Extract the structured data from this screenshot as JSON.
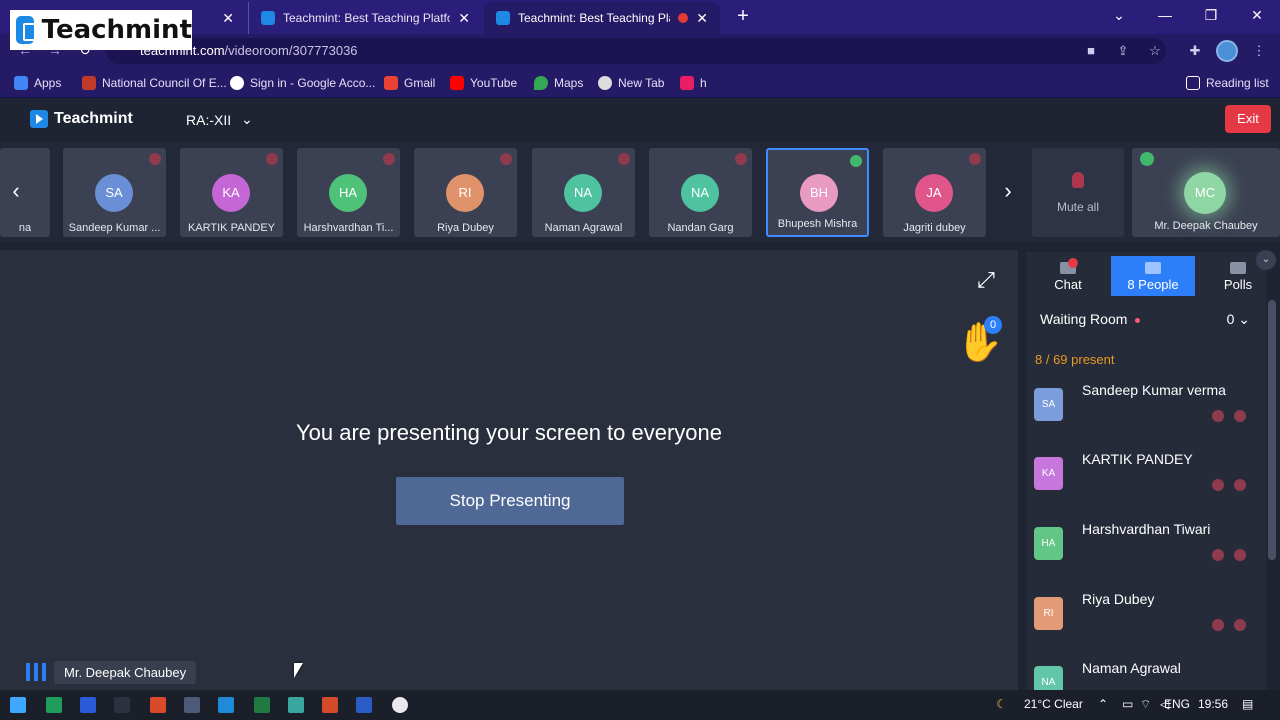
{
  "overlay_logo": "Teachmint",
  "browser": {
    "tabs": [
      {
        "title": "",
        "close": "✕"
      },
      {
        "title": "Teachmint: Best Teaching Platform",
        "close": "✕"
      },
      {
        "title": "Teachmint: Best Teaching Platfo",
        "close": "✕"
      }
    ],
    "new_tab": "+",
    "window_controls": {
      "dropdown": "⌄",
      "minimize": "—",
      "restore": "❐",
      "close": "✕"
    },
    "url_host": "teachmint.com",
    "url_path": "/videoroom/307773036",
    "bookmarks": [
      {
        "label": "Apps",
        "icon": "apps-grid-icon",
        "color": "#4285f4"
      },
      {
        "label": "National Council Of E...",
        "icon": "ncert-icon",
        "color": "#c0392b"
      },
      {
        "label": "Sign in - Google Acco...",
        "icon": "google-icon",
        "color": "#ffffff"
      },
      {
        "label": "Gmail",
        "icon": "gmail-icon",
        "color": "#ea4335"
      },
      {
        "label": "YouTube",
        "icon": "youtube-icon",
        "color": "#ff0000"
      },
      {
        "label": "Maps",
        "icon": "maps-icon",
        "color": "#34a853"
      },
      {
        "label": "New Tab",
        "icon": "globe-icon",
        "color": "#dddddd"
      },
      {
        "label": "h",
        "icon": "bookmark-h-icon",
        "color": "#e91e63"
      }
    ],
    "reading_list": "Reading list"
  },
  "app": {
    "brand": "Teachmint",
    "class_name": "RA:-XII",
    "exit_label": "Exit",
    "participants": [
      {
        "initials": "SA",
        "name": "Sandeep Kumar ...",
        "color": "#6b8fd6"
      },
      {
        "initials": "KA",
        "name": "KARTIK PANDEY",
        "color": "#c566d6"
      },
      {
        "initials": "HA",
        "name": "Harshvardhan Ti...",
        "color": "#4fc27a"
      },
      {
        "initials": "RI",
        "name": "Riya Dubey",
        "color": "#e0936a"
      },
      {
        "initials": "NA",
        "name": "Naman Agrawal",
        "color": "#4fc2a0"
      },
      {
        "initials": "NA",
        "name": "Nandan Garg",
        "color": "#4fc2a0"
      },
      {
        "initials": "BH",
        "name": "Bhupesh Mishra",
        "color": "#e99ac0"
      },
      {
        "initials": "JA",
        "name": "Jagriti dubey",
        "color": "#e0568a"
      }
    ],
    "partial_tile_name": "na",
    "mute_all": "Mute all",
    "host": {
      "initials": "MC",
      "name": "Mr. Deepak Chaubey"
    },
    "presenting_text": "You are presenting your screen to everyone",
    "stop_presenting": "Stop Presenting",
    "raised_hands": "0",
    "speaker_name": "Mr. Deepak Chaubey",
    "panel": {
      "tabs": [
        {
          "label": "Chat"
        },
        {
          "label": "8 People"
        },
        {
          "label": "Polls"
        }
      ],
      "waiting_room": "Waiting Room",
      "waiting_count": "0",
      "present_text": "8 / 69 present",
      "people": [
        {
          "initials": "SA",
          "name": "Sandeep Kumar verma",
          "color": "#7c9ddc"
        },
        {
          "initials": "KA",
          "name": "KARTIK PANDEY",
          "color": "#c777dc"
        },
        {
          "initials": "HA",
          "name": "Harshvardhan Tiwari",
          "color": "#62c786"
        },
        {
          "initials": "RI",
          "name": "Riya Dubey",
          "color": "#e39a76"
        },
        {
          "initials": "NA",
          "name": "Naman Agrawal",
          "color": "#62c7a9"
        }
      ]
    }
  },
  "taskbar": {
    "weather": "21°C  Clear",
    "language": "ENG",
    "time": "19:56"
  }
}
